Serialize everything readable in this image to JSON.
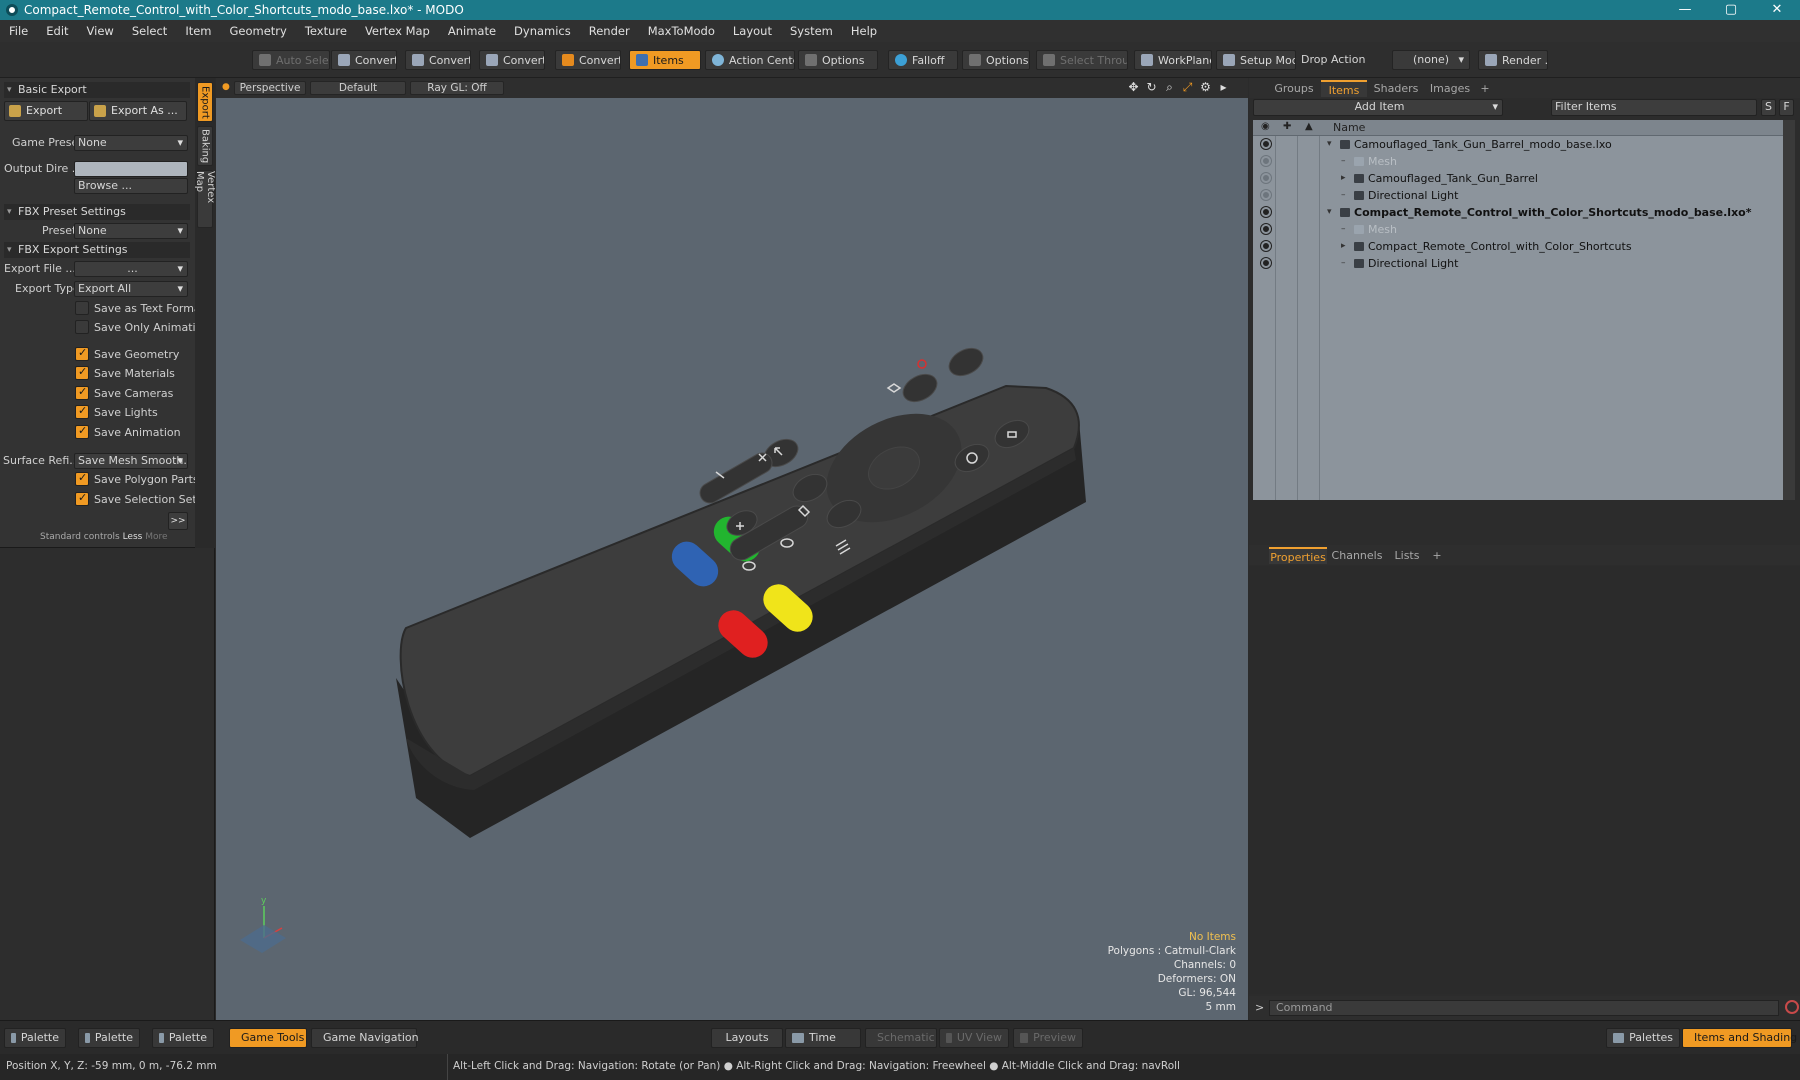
{
  "window": {
    "title": "Compact_Remote_Control_with_Color_Shortcuts_modo_base.lxo* - MODO",
    "controls": [
      "—",
      "▢",
      "✕"
    ]
  },
  "menu": [
    "File",
    "Edit",
    "View",
    "Select",
    "Item",
    "Geometry",
    "Texture",
    "Vertex Map",
    "Animate",
    "Dynamics",
    "Render",
    "MaxToModo",
    "Layout",
    "System",
    "Help"
  ],
  "toolbar": {
    "auto_select": "Auto Select",
    "convert1": "Convert",
    "convert2": "Convert",
    "convert3": "Convert",
    "convert4": "Convert",
    "items": "Items",
    "action_center": "Action Center",
    "options1": "Options",
    "falloff": "Falloff",
    "options2": "Options",
    "select_through": "Select Through",
    "workplane": "WorkPlane",
    "setup_mode": "Setup Mode",
    "drop_action_label": "Drop Action",
    "drop_action_value": "(none)",
    "render": "Render ..."
  },
  "left_panel": {
    "side_tabs": [
      "Export",
      "Baking",
      "Vertex Map"
    ],
    "basic_export": "Basic Export",
    "export_btn": "Export",
    "export_as_btn": "Export As ...",
    "game_preset_label": "Game Preset",
    "game_preset_value": "None",
    "output_dir_label": "Output Dire ...",
    "output_dir_value": "",
    "browse": "Browse ...",
    "fbx_preset_settings": "FBX Preset Settings",
    "preset_label": "Preset",
    "preset_value": "None",
    "fbx_export_settings": "FBX Export Settings",
    "export_file_label": "Export File ...",
    "export_file_value": "...",
    "export_type_label": "Export Type",
    "export_type_value": "Export All",
    "checkboxes": [
      {
        "label": "Save as Text Format",
        "checked": false
      },
      {
        "label": "Save Only Animation",
        "checked": false
      },
      {
        "label": "Save Geometry",
        "checked": true
      },
      {
        "label": "Save Materials",
        "checked": true
      },
      {
        "label": "Save Cameras",
        "checked": true
      },
      {
        "label": "Save Lights",
        "checked": true
      },
      {
        "label": "Save Animation",
        "checked": true
      }
    ],
    "surface_refi_label": "Surface Refi...",
    "surface_refi_value": "Save Mesh Smooth...",
    "checkboxes2": [
      {
        "label": "Save Polygon Parts",
        "checked": true
      },
      {
        "label": "Save Selection Sets",
        "checked": true
      }
    ],
    "more_btn": ">>",
    "standard_controls": "Standard controls",
    "less": "Less",
    "more": "More"
  },
  "viewport": {
    "tab_perspective": "Perspective",
    "tab_default": "Default",
    "tab_raygl": "Ray GL: Off",
    "info": {
      "no_items": "No Items",
      "polygons": "Polygons : Catmull-Clark",
      "channels": "Channels: 0",
      "deformers": "Deformers: ON",
      "gl": "GL: 96,544",
      "scale": "5 mm"
    },
    "remote_colors": {
      "body": "#3d3d3d",
      "blue": "#2f63b3",
      "green": "#22b52f",
      "red": "#e02020",
      "yellow": "#f0e41a"
    }
  },
  "right_panel": {
    "tabs": [
      "Groups",
      "Items",
      "Shaders",
      "Images",
      "+"
    ],
    "add_item": "Add Item",
    "filter_items": "Filter Items",
    "col_name": "Name",
    "btn_s": "S",
    "btn_f": "F",
    "tree": [
      {
        "name": "Camouflaged_Tank_Gun_Barrel_modo_base.lxo",
        "level": 0,
        "bold": false,
        "dim": false,
        "expander": "▾",
        "eye": true,
        "eye_dim": false
      },
      {
        "name": "Mesh",
        "level": 1,
        "bold": false,
        "dim": true,
        "expander": "",
        "eye": true,
        "eye_dim": true
      },
      {
        "name": "Camouflaged_Tank_Gun_Barrel",
        "level": 1,
        "bold": false,
        "dim": false,
        "expander": "▸",
        "eye": true,
        "eye_dim": true
      },
      {
        "name": "Directional Light",
        "level": 1,
        "bold": false,
        "dim": false,
        "expander": "",
        "eye": true,
        "eye_dim": true
      },
      {
        "name": "Compact_Remote_Control_with_Color_Shortcuts_modo_base.lxo*",
        "level": 0,
        "bold": true,
        "dim": false,
        "expander": "▾",
        "eye": true,
        "eye_dim": false
      },
      {
        "name": "Mesh",
        "level": 1,
        "bold": false,
        "dim": true,
        "expander": "",
        "eye": true,
        "eye_dim": false
      },
      {
        "name": "Compact_Remote_Control_with_Color_Shortcuts",
        "level": 1,
        "bold": false,
        "dim": false,
        "expander": "▸",
        "eye": true,
        "eye_dim": false
      },
      {
        "name": "Directional Light",
        "level": 1,
        "bold": false,
        "dim": false,
        "expander": "",
        "eye": true,
        "eye_dim": false
      }
    ],
    "props_tabs": [
      "Properties",
      "Channels",
      "Lists",
      "+"
    ],
    "command_placeholder": "Command",
    "command_prompt": ">"
  },
  "bottom_bar": {
    "palette1": "Palette",
    "palette2": "Palette",
    "palette3": "Palette",
    "game_tools": "Game Tools",
    "game_navigation": "Game Navigation",
    "layouts": "Layouts",
    "time": "Time",
    "schematic": "Schematic",
    "uv_view": "UV View",
    "preview": "Preview",
    "palettes": "Palettes",
    "items_and_shading": "Items and Shading"
  },
  "status": {
    "position": "Position X, Y, Z:  -59 mm, 0 m, -76.2 mm",
    "hint": "Alt-Left Click and Drag: Navigation: Rotate (or Pan) ● Alt-Right Click and Drag: Navigation: Freewheel ● Alt-Middle Click and Drag: navRoll"
  }
}
